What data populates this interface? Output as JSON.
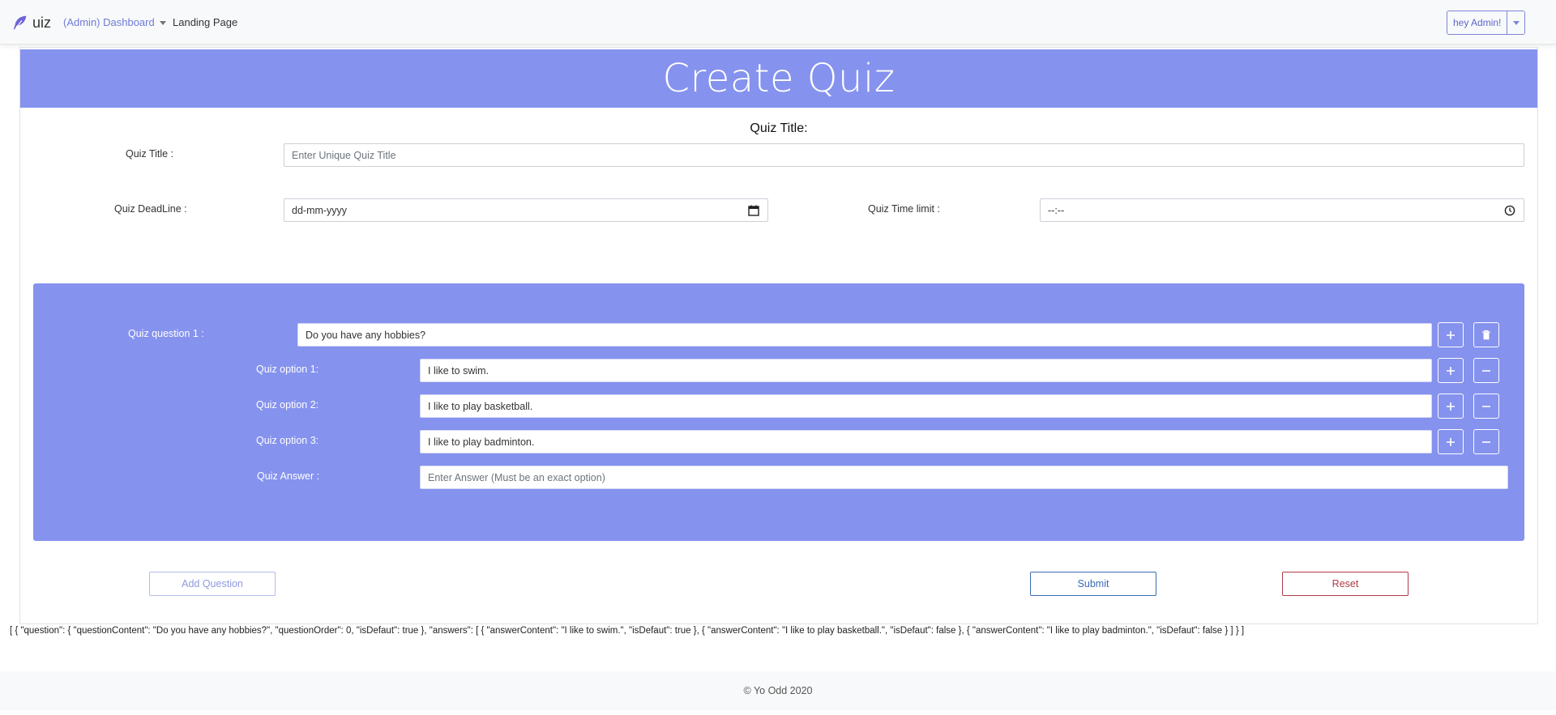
{
  "navbar": {
    "brand_text": "uiz",
    "dashboard_label": "(Admin) Dashboard",
    "landing_label": "Landing Page",
    "user_label": "hey Admin!"
  },
  "page": {
    "banner_title": "Create Quiz",
    "section_title": "Quiz Title:"
  },
  "form": {
    "title_label": "Quiz Title :",
    "title_placeholder": "Enter Unique Quiz Title",
    "deadline_label": "Quiz DeadLine :",
    "deadline_value": "dd-mm-yyyy",
    "timelimit_label": "Quiz Time limit :",
    "timelimit_value": "--:--"
  },
  "question": {
    "label": "Quiz question 1 :",
    "value": "Do you have any hobbies?",
    "options": [
      {
        "label": "Quiz option 1:",
        "value": "I like to swim."
      },
      {
        "label": "Quiz option 2:",
        "value": "I like to play basketball."
      },
      {
        "label": "Quiz option 3:",
        "value": "I like to play badminton."
      }
    ],
    "answer_label": "Quiz Answer :",
    "answer_placeholder": "Enter Answer (Must be an exact option)"
  },
  "buttons": {
    "add_question": "Add Question",
    "submit": "Submit",
    "reset": "Reset"
  },
  "json_dump": "[ { \"question\": { \"questionContent\": \"Do you have any hobbies?\", \"questionOrder\": 0, \"isDefaut\": true }, \"answers\": [ { \"answerContent\": \"I like to swim.\", \"isDefaut\": true }, { \"answerContent\": \"I like to play basketball.\", \"isDefaut\": false }, { \"answerContent\": \"I like to play badminton.\", \"isDefaut\": false } ] } ]",
  "footer": {
    "text": "© Yo Odd 2020"
  },
  "colors": {
    "accent": "#8592ee",
    "link": "#6f7bd8",
    "submit": "#3a6ab6",
    "reset": "#b03a48"
  },
  "icons": [
    "feather-icon",
    "calendar-icon",
    "clock-icon",
    "plus-icon",
    "trash-icon",
    "minus-icon",
    "chevron-down-icon"
  ]
}
